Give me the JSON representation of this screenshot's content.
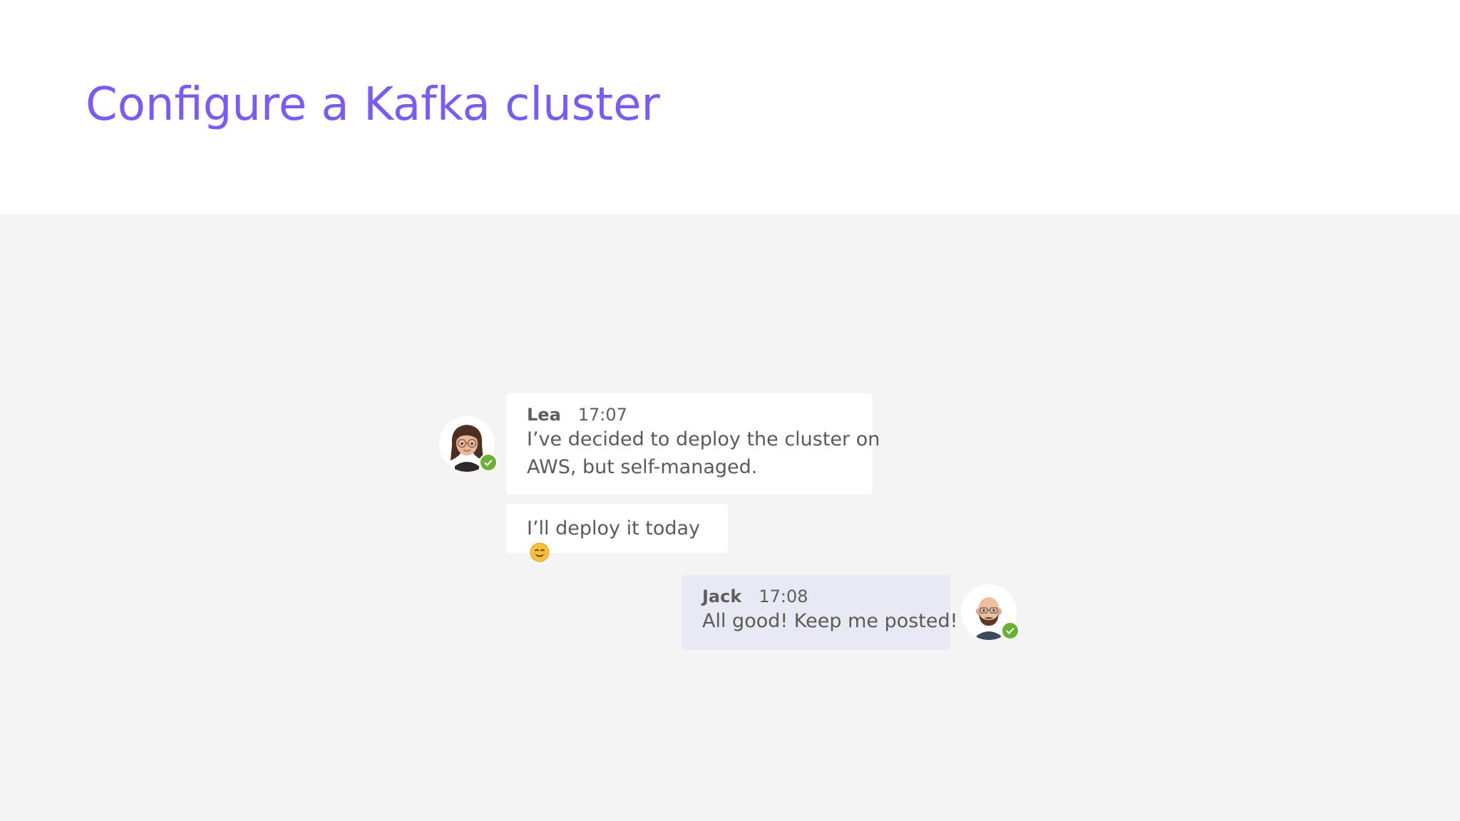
{
  "page": {
    "title": "Configure a Kafka cluster",
    "accent_color": "#7b5cf2"
  },
  "chat": {
    "messages": [
      {
        "sender": "Lea",
        "time": "17:07",
        "avatar_icon": "lea-avatar-icon",
        "status": "online",
        "lines": [
          "I’ve decided to deploy the cluster on",
          "AWS, but self-managed."
        ]
      },
      {
        "sender": "Lea",
        "text": "I’ll deploy it today",
        "emoji_icon": "smiling-face-icon"
      },
      {
        "sender": "Jack",
        "time": "17:08",
        "avatar_icon": "jack-avatar-icon",
        "status": "online",
        "text": "All good! Keep me posted!"
      }
    ],
    "status_color": "#6bb135"
  }
}
